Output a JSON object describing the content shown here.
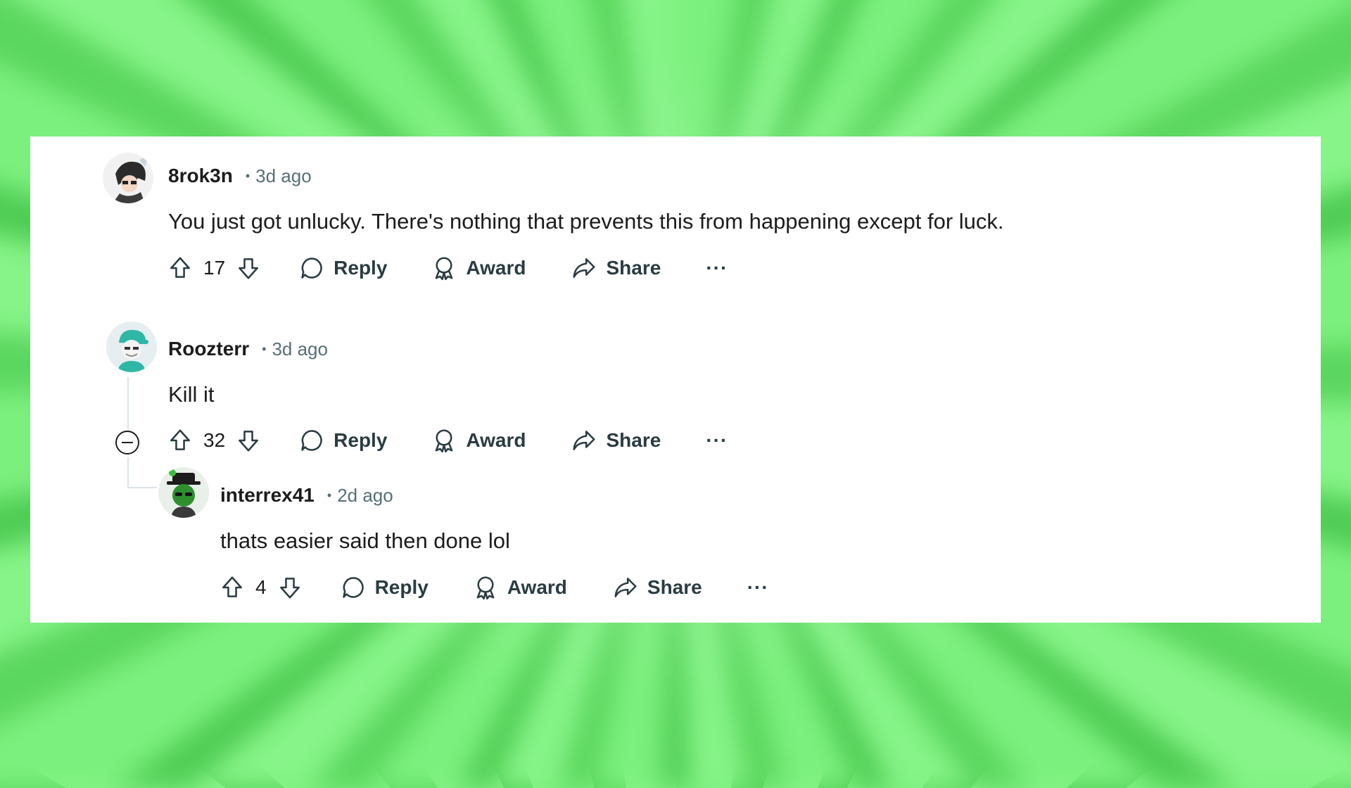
{
  "comments": [
    {
      "author": "8rok3n",
      "separator": "•",
      "time": "3d ago",
      "text": "You just got unlucky. There's nothing that prevents this from happening except for luck.",
      "votes": "17",
      "reply_label": "Reply",
      "award_label": "Award",
      "share_label": "Share",
      "more_label": "···"
    },
    {
      "author": "Roozterr",
      "separator": "•",
      "time": "3d ago",
      "text": "Kill it",
      "votes": "32",
      "reply_label": "Reply",
      "award_label": "Award",
      "share_label": "Share",
      "more_label": "···"
    },
    {
      "author": "interrex41",
      "separator": "•",
      "time": "2d ago",
      "text": "thats easier said then done lol",
      "votes": "4",
      "reply_label": "Reply",
      "award_label": "Award",
      "share_label": "Share",
      "more_label": "···"
    }
  ],
  "colors": {
    "background": "#6fe872",
    "panel": "#ffffff",
    "text": "#1c1c1c",
    "meta": "#576f76",
    "thread_line": "#dde3e6"
  },
  "icons": [
    "upvote-icon",
    "downvote-icon",
    "reply-bubble-icon",
    "award-icon",
    "share-arrow-icon",
    "collapse-minus-icon"
  ]
}
